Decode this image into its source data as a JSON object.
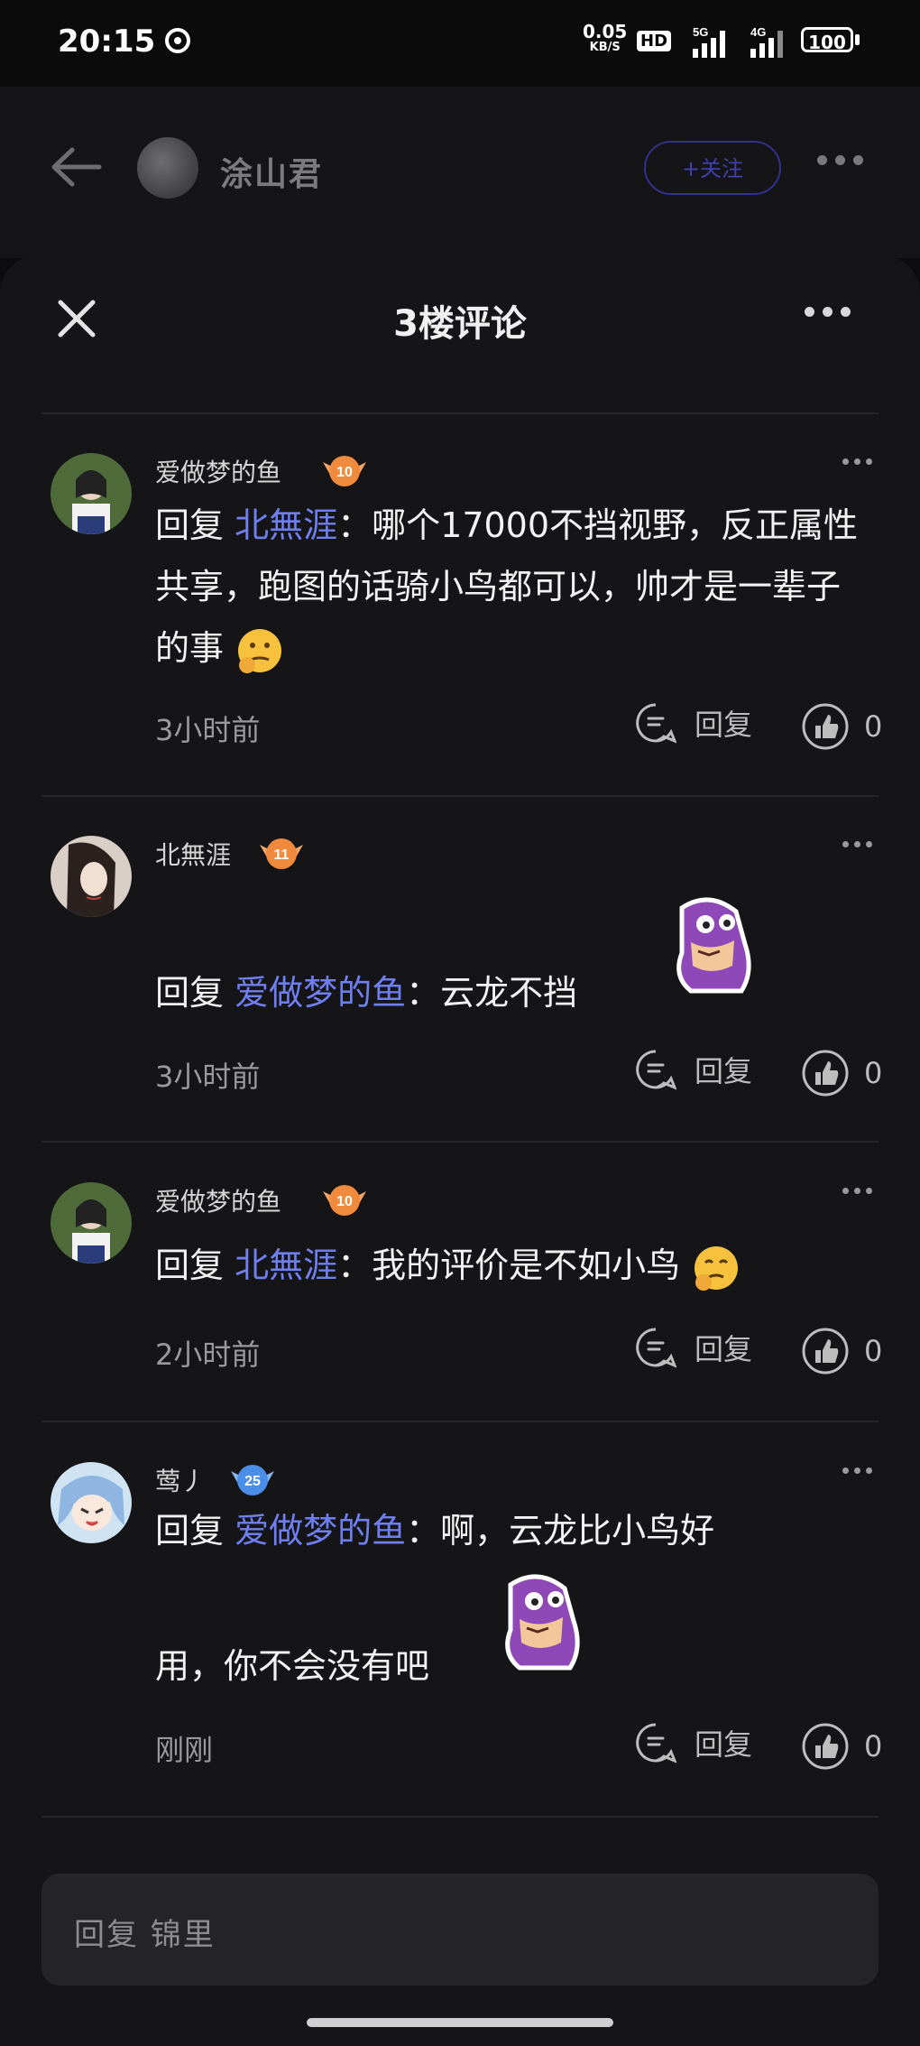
{
  "status_bar": {
    "time": "20:15",
    "speed": "0.05",
    "speed_unit": "KB/S",
    "hd": "HD",
    "net1": "5G",
    "net2": "4G",
    "battery": "100"
  },
  "header": {
    "user_name": "涂山君",
    "follow_label": "+关注"
  },
  "sheet": {
    "title": "3楼评论"
  },
  "comments": [
    {
      "user": "爱做梦的鱼",
      "level": "10",
      "reply_prefix": "回复",
      "mention": "北無涯",
      "sep": "：",
      "text": "哪个17000不挡视野，反正属性共享，跑图的话骑小鸟都可以，帅才是一辈子的事",
      "time": "3小时前",
      "reply_label": "回复",
      "likes": "0"
    },
    {
      "user": "北無涯",
      "level": "11",
      "reply_prefix": "回复",
      "mention": "爱做梦的鱼",
      "sep": "：",
      "text": "云龙不挡",
      "time": "3小时前",
      "reply_label": "回复",
      "likes": "0"
    },
    {
      "user": "爱做梦的鱼",
      "level": "10",
      "reply_prefix": "回复",
      "mention": "北無涯",
      "sep": "：",
      "text": "我的评价是不如小鸟",
      "time": "2小时前",
      "reply_label": "回复",
      "likes": "0"
    },
    {
      "user": "莺丿",
      "level": "25",
      "reply_prefix": "回复",
      "mention": "爱做梦的鱼",
      "sep": "：",
      "text": "啊，云龙比小鸟好",
      "text2": "用，你不会没有吧",
      "time": "刚刚",
      "reply_label": "回复",
      "likes": "0"
    }
  ],
  "input": {
    "placeholder": "回复 锦里"
  },
  "colors": {
    "mention": "#6f7ff0",
    "background": "#151517",
    "badge_orange": "#f08a3c",
    "badge_blue": "#4a8ee8"
  }
}
